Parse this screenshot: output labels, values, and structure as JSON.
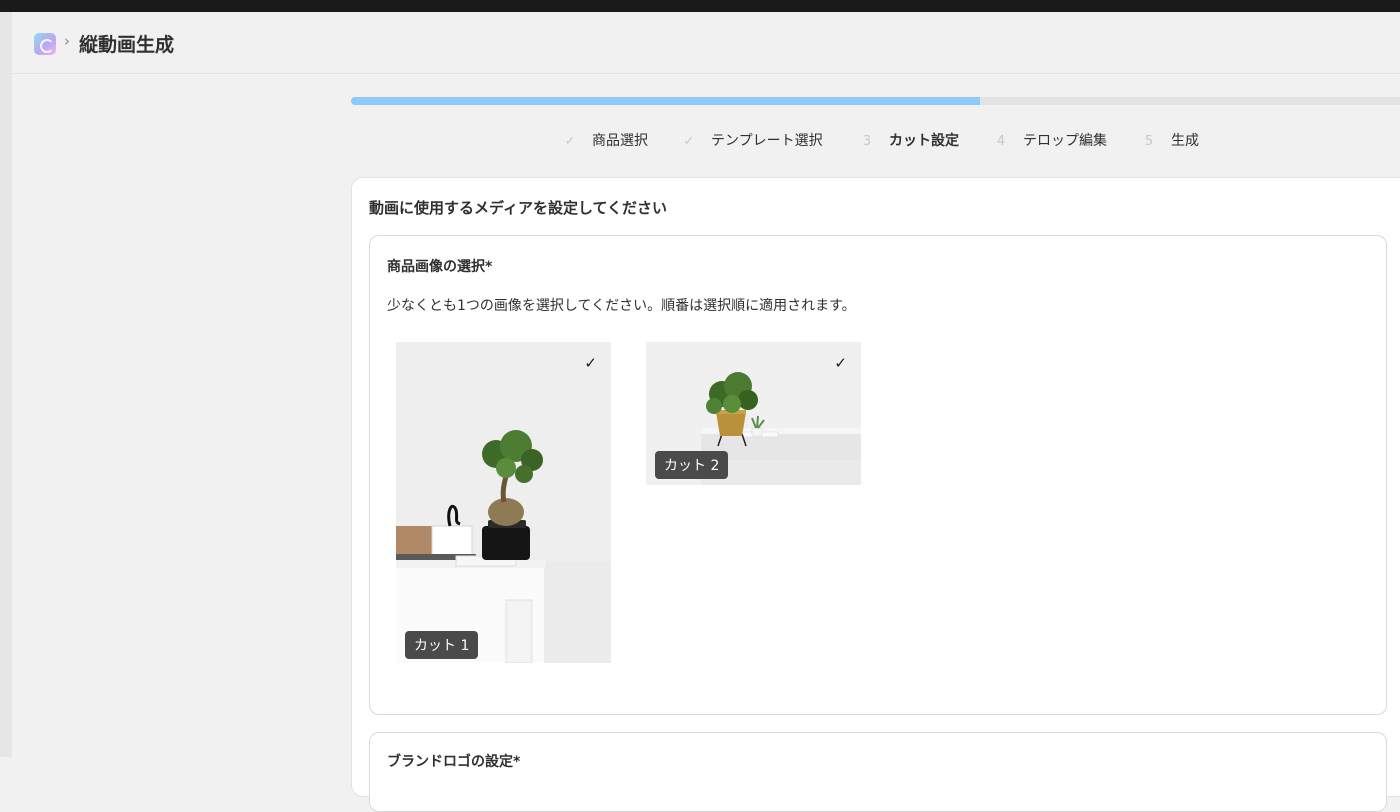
{
  "header": {
    "separator": "›",
    "title": "縦動画生成"
  },
  "progress": {
    "fraction": 0.6
  },
  "steps": [
    {
      "mark": "✓",
      "label": "商品選択",
      "state": "done"
    },
    {
      "mark": "✓",
      "label": "テンプレート選択",
      "state": "done"
    },
    {
      "mark": "3",
      "label": "カット設定",
      "state": "active"
    },
    {
      "mark": "4",
      "label": "テロップ編集",
      "state": "todo"
    },
    {
      "mark": "5",
      "label": "生成",
      "state": "todo"
    }
  ],
  "card": {
    "title": "動画に使用するメディアを設定してください",
    "image_section": {
      "title": "商品画像の選択*",
      "description": "少なくとも1つの画像を選択してください。順番は選択順に適用されます。",
      "images": [
        {
          "badge": "カット 1",
          "selected": true,
          "check": "✓"
        },
        {
          "badge": "カット 2",
          "selected": true,
          "check": "✓"
        }
      ]
    },
    "logo_section": {
      "title": "ブランドロゴの設定*"
    }
  },
  "colors": {
    "progress": "#8ecbf8",
    "badge": "#4a4a4a"
  }
}
